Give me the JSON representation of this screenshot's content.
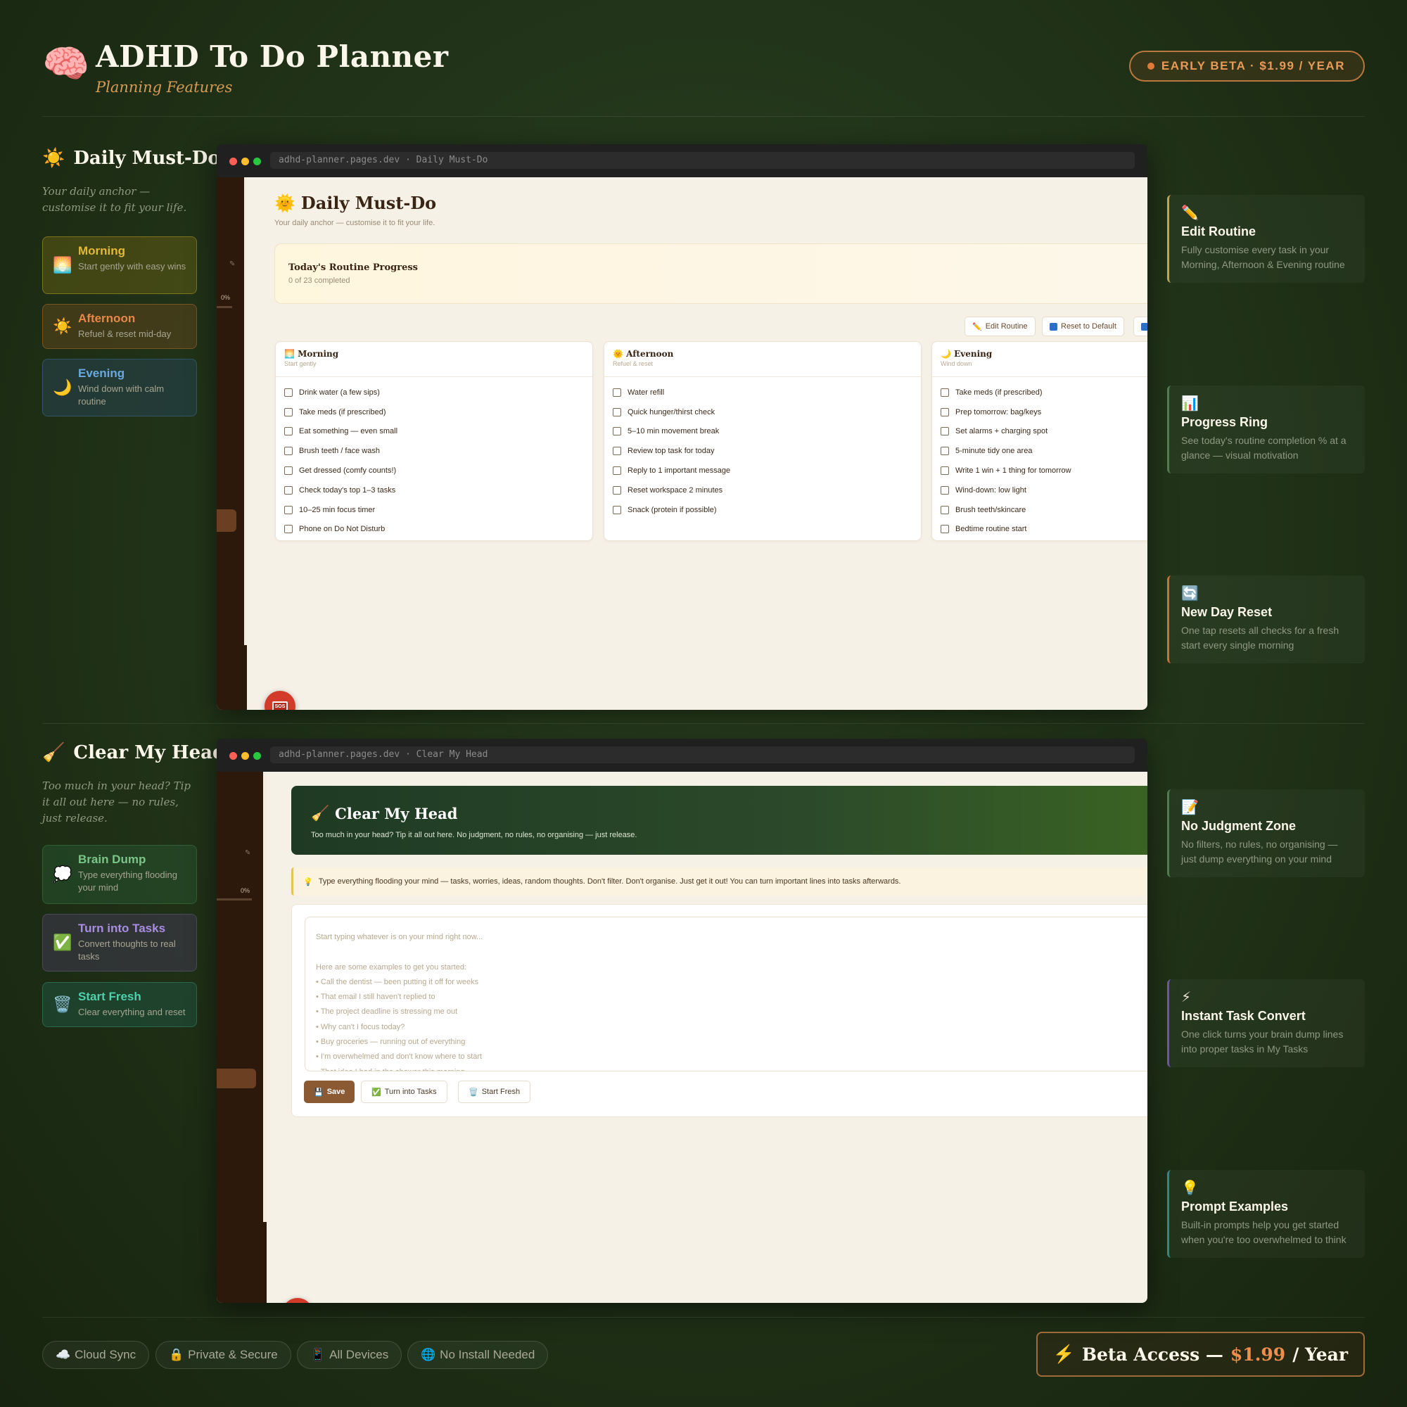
{
  "header": {
    "title": "ADHD To Do Planner",
    "subtitle": "Planning Features",
    "beta_label": "EARLY BETA · $1.99 / YEAR",
    "accent": "#e99a58"
  },
  "daily": {
    "heading": "Daily Must-Do",
    "description": "Your daily anchor — customise it to fit your life.",
    "cards": [
      {
        "title": "Morning",
        "desc": "Start gently with easy wins",
        "icon": "sunrise-icon"
      },
      {
        "title": "Afternoon",
        "desc": "Refuel & reset mid-day",
        "icon": "sun-icon"
      },
      {
        "title": "Evening",
        "desc": "Wind down with calm routine",
        "icon": "moon-icon"
      }
    ],
    "browser": {
      "url": "adhd-planner.pages.dev · Daily Must-Do",
      "title": "Daily Must-Do",
      "subtitle": "Your daily anchor — customise it to fit your life.",
      "progress_title": "Today's Routine Progress",
      "progress_count": "0 of 23 completed",
      "side_percent": "0%",
      "buttons": {
        "edit": "Edit Routine",
        "reset": "Reset to Default"
      },
      "columns": [
        {
          "title": "Morning",
          "sub": "Start gently",
          "items": [
            "Drink water (a few sips)",
            "Take meds (if prescribed)",
            "Eat something — even small",
            "Brush teeth / face wash",
            "Get dressed (comfy counts!)",
            "Check today's top 1–3 tasks",
            "10–25 min focus timer",
            "Phone on Do Not Disturb"
          ]
        },
        {
          "title": "Afternoon",
          "sub": "Refuel & reset",
          "items": [
            "Water refill",
            "Quick hunger/thirst check",
            "5–10 min movement break",
            "Review top task for today",
            "Reply to 1 important message",
            "Reset workspace 2 minutes",
            "Snack (protein if possible)"
          ]
        },
        {
          "title": "Evening",
          "sub": "Wind down",
          "items": [
            "Take meds (if prescribed)",
            "Prep tomorrow: bag/keys",
            "Set alarms + charging spot",
            "5-minute tidy one area",
            "Write 1 win + 1 thing for tomorrow",
            "Wind-down: low light",
            "Brush teeth/skincare",
            "Bedtime routine start"
          ]
        }
      ]
    }
  },
  "clear": {
    "heading": "Clear My Head",
    "description": "Too much in your head? Tip it all out here — no rules, just release.",
    "cards": [
      {
        "title": "Brain Dump",
        "desc": "Type everything flooding your mind",
        "icon": "thought-bubble-icon"
      },
      {
        "title": "Turn into Tasks",
        "desc": "Convert thoughts to real tasks",
        "icon": "check-icon"
      },
      {
        "title": "Start Fresh",
        "desc": "Clear everything and reset",
        "icon": "trash-icon"
      }
    ],
    "browser": {
      "url": "adhd-planner.pages.dev · Clear My Head",
      "title": "Clear My Head",
      "subtitle": "Too much in your head? Tip it all out here. No judgment, no rules, no organising — just release.",
      "side_percent": "0%",
      "tip": "Type everything flooding your mind — tasks, worries, ideas, random thoughts. Don't filter. Don't organise. Just get it out! You can turn important lines into tasks afterwards.",
      "placeholder_lines": [
        "Start typing whatever is on your mind right now...",
        "",
        "Here are some examples to get you started:",
        "• Call the dentist — been putting it off for weeks",
        "• That email I still haven't replied to",
        "• The project deadline is stressing me out",
        "• Why can't I focus today?",
        "• Buy groceries — running out of everything",
        "• I'm overwhelmed and don't know where to start",
        "• That idea I had in the shower this morning"
      ],
      "buttons": {
        "save": "Save",
        "tasks": "Turn into Tasks",
        "fresh": "Start Fresh"
      }
    }
  },
  "features": [
    {
      "icon": "pencil-icon",
      "title": "Edit Routine",
      "desc": "Fully customise every task in your Morning, Afternoon & Evening routine",
      "color": "#c9a24a"
    },
    {
      "icon": "bar-chart-icon",
      "title": "Progress Ring",
      "desc": "See today's routine completion % at a glance — visual motivation",
      "color": "#4f7d4f"
    },
    {
      "icon": "refresh-icon",
      "title": "New Day Reset",
      "desc": "One tap resets all checks for a fresh start every single morning",
      "color": "#c9733a"
    },
    {
      "icon": "memo-icon",
      "title": "No Judgment Zone",
      "desc": "No filters, no rules, no organising — just dump everything on your mind",
      "color": "#4f7d4f"
    },
    {
      "icon": "lightning-icon",
      "title": "Instant Task Convert",
      "desc": "One click turns your brain dump lines into proper tasks in My Tasks",
      "color": "#6b56a8"
    },
    {
      "icon": "lightbulb-icon",
      "title": "Prompt Examples",
      "desc": "Built-in prompts help you get started when you're too overwhelmed to think",
      "color": "#2f8a86"
    }
  ],
  "footer": {
    "pills": [
      {
        "icon": "cloud-icon",
        "label": "Cloud Sync"
      },
      {
        "icon": "lock-icon",
        "label": "Private & Secure"
      },
      {
        "icon": "phone-icon",
        "label": "All Devices"
      },
      {
        "icon": "globe-icon",
        "label": "No Install Needed"
      }
    ],
    "cta_prefix": "Beta Access —",
    "cta_price": "$1.99",
    "cta_suffix": "/ Year"
  }
}
